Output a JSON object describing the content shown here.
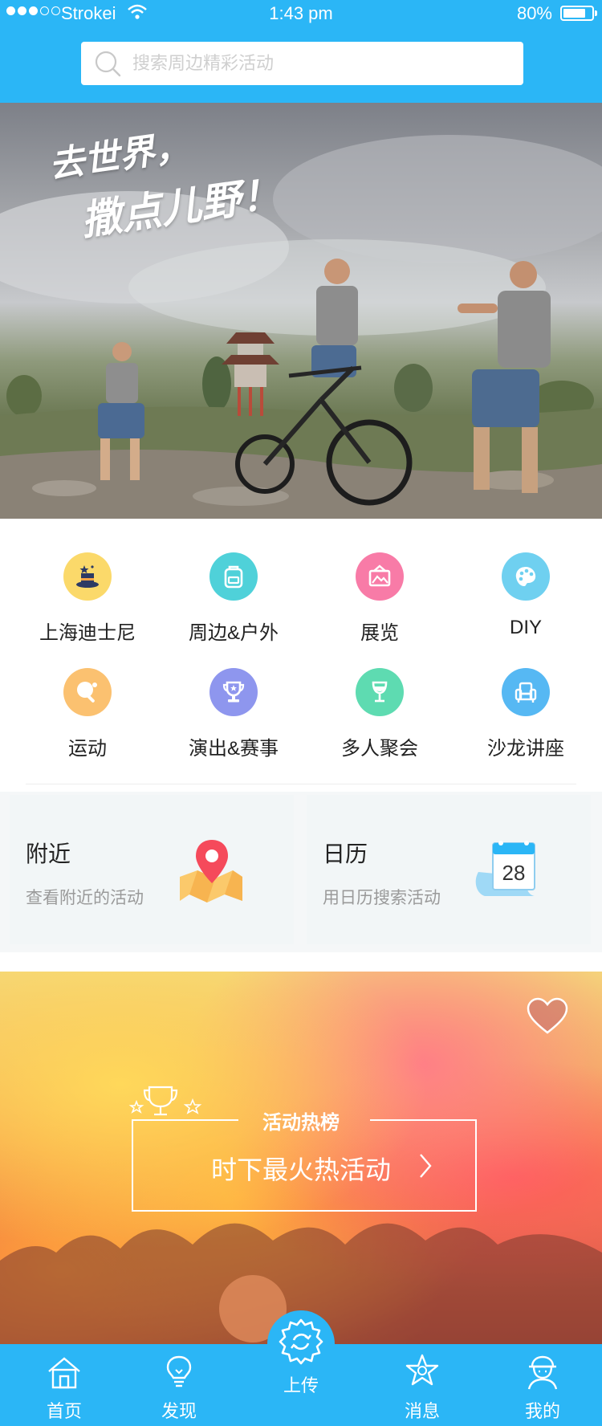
{
  "status_bar": {
    "carrier": "Strokei",
    "time": "1:43 pm",
    "battery": "80%"
  },
  "search": {
    "placeholder": "搜索周边精彩活动"
  },
  "banner": {
    "slogan_line1": "去世界，",
    "slogan_line2": "撒点儿野！"
  },
  "categories": [
    {
      "label": "上海迪士尼",
      "icon": "magic-hat-icon",
      "color": "#fbd96a"
    },
    {
      "label": "周边&户外",
      "icon": "backpack-icon",
      "color": "#4fd1d9"
    },
    {
      "label": "展览",
      "icon": "picture-icon",
      "color": "#f87ba7"
    },
    {
      "label": "DIY",
      "icon": "palette-icon",
      "color": "#6fd0f0"
    },
    {
      "label": "运动",
      "icon": "ping-pong-icon",
      "color": "#fbc170"
    },
    {
      "label": "演出&赛事",
      "icon": "trophy-icon",
      "color": "#8e96ee"
    },
    {
      "label": "多人聚会",
      "icon": "wine-glass-icon",
      "color": "#5edbb1"
    },
    {
      "label": "沙龙讲座",
      "icon": "armchair-icon",
      "color": "#56b8f3"
    }
  ],
  "tiles": {
    "nearby": {
      "title": "附近",
      "subtitle": "查看附近的活动"
    },
    "calendar": {
      "title": "日历",
      "subtitle": "用日历搜索活动",
      "day": "28"
    }
  },
  "hot": {
    "subtitle": "活动热榜",
    "title": "时下最火热活动"
  },
  "tabbar": [
    {
      "label": "首页",
      "icon": "home-icon"
    },
    {
      "label": "发现",
      "icon": "bulb-icon"
    },
    {
      "label": "上传",
      "icon": "upload-gear-icon"
    },
    {
      "label": "消息",
      "icon": "star-message-icon"
    },
    {
      "label": "我的",
      "icon": "profile-icon"
    }
  ],
  "colors": {
    "brand": "#2bb6f6"
  }
}
